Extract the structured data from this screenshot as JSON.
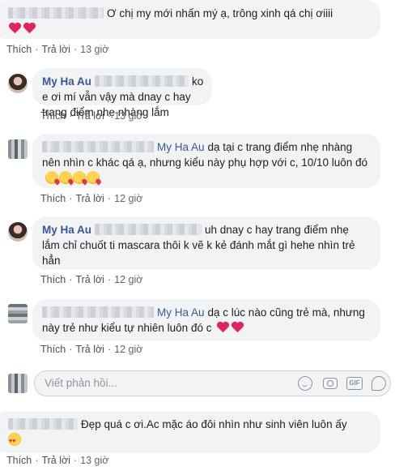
{
  "comments": [
    {
      "name": "",
      "tag": "",
      "text": "Ơ chị my mới nhấn mý ạ, trông xinh qá chị ơiiii",
      "reactions": "hearts2",
      "actions": {
        "like": "Thích",
        "reply": "Trả lời",
        "time": "13 giờ"
      }
    },
    {
      "name": "My Ha Au",
      "text": "ko e ơi mí vẫn vậy mà dnay c hay trang điểm nhẹ nhàng lắm",
      "actions": {
        "like": "Thích",
        "reply": "Trả lời",
        "time": "13 giờ"
      }
    },
    {
      "name": "",
      "tag": "My Ha Au",
      "text_line1": "dạ tại c trang điểm nhẹ nhàng",
      "text_rest": "nên nhìn c khác qá ạ, nhưng kiểu này phụ hợp với c, 10/10 luôn đó",
      "actions": {
        "like": "Thích",
        "reply": "Trả lời",
        "time": "12 giờ"
      }
    },
    {
      "name": "My Ha Au",
      "text_line1": "uh dnay c hay trang điểm nhẹ",
      "text_rest": "lắm chỉ chuốt ti mascara thôi k vẽ k kẻ đánh mắt gì hehe nhìn trẻ hẳn",
      "actions": {
        "like": "Thích",
        "reply": "Trả lời",
        "time": "12 giờ"
      }
    },
    {
      "name": "",
      "tag": "My Ha Au",
      "text_line1": "dạ c lúc nào cũng trẻ mà, nhưng",
      "text_rest": "này trẻ như kiểu tự nhiên luôn đó c",
      "actions": {
        "like": "Thích",
        "reply": "Trả lời",
        "time": "12 giờ"
      }
    },
    {
      "name": "",
      "text": "Đẹp quá c ơi.Ac mặc áo đôi nhìn như sinh viên luôn ấy",
      "actions": {
        "like": "Thích",
        "reply": "Trả lời",
        "time": "13 giờ"
      }
    }
  ],
  "reply_box": {
    "placeholder": "Viết phản hồi...",
    "gif_label": "GIF"
  },
  "icons": {
    "emoji": "smile-icon",
    "camera": "camera-icon",
    "gif": "gif-icon",
    "sticker": "sticker-icon"
  },
  "colors": {
    "link": "#385898",
    "bubble": "#f2f3f5",
    "meta": "#606770",
    "heart": "#e0245e"
  }
}
